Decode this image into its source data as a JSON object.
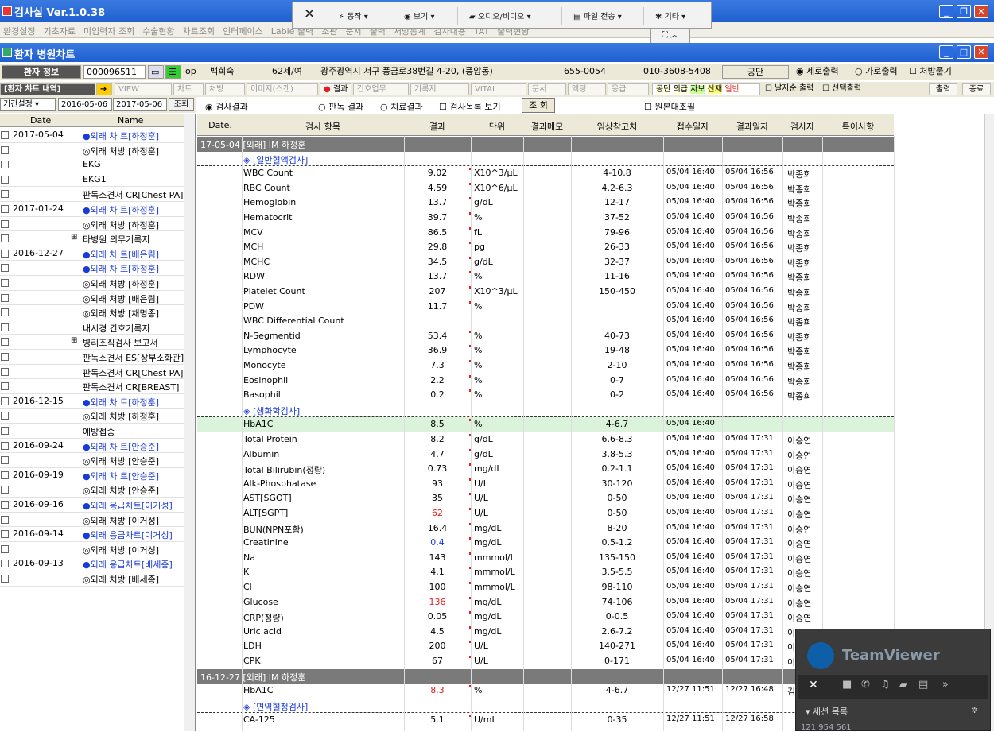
{
  "window": {
    "title": "검사실 Ver.1.0.38"
  },
  "menu": [
    "환경설정",
    "기초자료",
    "미입력자 조회",
    "수술현황",
    "차트조회",
    "인터페이스",
    "Lable 출력",
    "조판",
    "문서",
    "출력",
    "처방통계",
    "검사내용",
    "TAT",
    "출력현황"
  ],
  "teamviewer_toolbar": {
    "close": "✕",
    "actions": "동작",
    "view": "보기",
    "audio_video": "오디오/비디오",
    "file_transfer": "파일 전송",
    "extras": "기타"
  },
  "subwindow": {
    "title": "환자 병원차트"
  },
  "patient": {
    "label": "환자 정보",
    "id": "000096511",
    "op": "op",
    "name": "백희숙",
    "age_sex": "62세/여",
    "address": "광주광역시 서구 풍금로38번길 4-20, (풍암동)",
    "zip": "655-0054",
    "phone": "010-3608-5408",
    "insurance": "공단",
    "print_opts": [
      "세로출력",
      "가로출력",
      "처방풀기"
    ]
  },
  "chart_tabs": {
    "title": "[환자 챠트 내역]",
    "tabs": [
      "VIEW",
      "차트",
      "처방",
      "이미지(스캔)",
      "결과",
      "간호업무",
      "기록지",
      "VITAL",
      "문서",
      "액팅",
      "응급"
    ],
    "insurance_legend": [
      "공단",
      "의급",
      "자보",
      "산재",
      "일반"
    ],
    "checks": [
      "날자순 출력",
      "선택출력"
    ],
    "print": "출력",
    "exit": "종료"
  },
  "filter": {
    "label": "기간설정",
    "from": "2016-05-06",
    "to": "2017-05-06",
    "search": "조회"
  },
  "options": {
    "radio1": "검사결과",
    "radio2": "판독 결과",
    "radio3": "치료결과",
    "check1": "검사목록 보기",
    "search": "조 회",
    "check2": "원본대조필"
  },
  "left_list": {
    "headers": [
      "Date",
      "Name"
    ],
    "rows": [
      {
        "date": "2017-05-04",
        "name": "●외래 차  트[하정훈]",
        "blue": true
      },
      {
        "date": "",
        "name": "◎외래 처방 [하정훈]",
        "blue": false
      },
      {
        "date": "",
        "name": "EKG",
        "blue": false
      },
      {
        "date": "",
        "name": "EKG1",
        "blue": false
      },
      {
        "date": "",
        "name": "판독소견서 CR[Chest PA]",
        "blue": false
      },
      {
        "date": "2017-01-24",
        "name": "●외래 차  트[하정훈]",
        "blue": true
      },
      {
        "date": "",
        "name": "◎외래 처방 [하정훈]",
        "blue": false
      },
      {
        "date": "",
        "name": "타병원 의무기록지",
        "blue": false,
        "expand": "⊞"
      },
      {
        "date": "2016-12-27",
        "name": "●외래 차  트[배은림]",
        "blue": true
      },
      {
        "date": "",
        "name": "●외래 차  트[하정훈]",
        "blue": true
      },
      {
        "date": "",
        "name": "◎외래 처방 [하정훈]",
        "blue": false
      },
      {
        "date": "",
        "name": "◎외래 처방 [배은림]",
        "blue": false
      },
      {
        "date": "",
        "name": "◎외래 처방 [채명종]",
        "blue": false
      },
      {
        "date": "",
        "name": "내시경 간호기록지",
        "blue": false
      },
      {
        "date": "",
        "name": "병리조직검사 보고서",
        "blue": false,
        "expand": "⊞"
      },
      {
        "date": "",
        "name": "판독소견서 ES[상부소화관]",
        "blue": false
      },
      {
        "date": "",
        "name": "판독소견서 CR[Chest PA]",
        "blue": false
      },
      {
        "date": "",
        "name": "판독소견서 CR[BREAST]",
        "blue": false
      },
      {
        "date": "2016-12-15",
        "name": "●외래 차  트[하정훈]",
        "blue": true
      },
      {
        "date": "",
        "name": "◎외래 처방 [하정훈]",
        "blue": false
      },
      {
        "date": "",
        "name": "예방접종",
        "blue": false
      },
      {
        "date": "2016-09-24",
        "name": "●외래 차  트[안승준]",
        "blue": true
      },
      {
        "date": "",
        "name": "◎외래 처방 [안승준]",
        "blue": false
      },
      {
        "date": "2016-09-19",
        "name": "●외래 차  트[안승준]",
        "blue": true
      },
      {
        "date": "",
        "name": "◎외래 처방 [안승준]",
        "blue": false
      },
      {
        "date": "2016-09-16",
        "name": "●외래 응급차트[이거성]",
        "blue": true
      },
      {
        "date": "",
        "name": "◎외래 처방 [이거성]",
        "blue": false
      },
      {
        "date": "2016-09-14",
        "name": "●외래 응급차트[이거성]",
        "blue": true
      },
      {
        "date": "",
        "name": "◎외래 처방 [이거성]",
        "blue": false
      },
      {
        "date": "2016-09-13",
        "name": "●외래 응급차트[배세종]",
        "blue": true
      },
      {
        "date": "",
        "name": "◎외래 처방 [배세종]",
        "blue": false
      }
    ]
  },
  "results": {
    "headers": [
      "Date.",
      "검사 항목",
      "결과",
      "단위",
      "결과메모",
      "임상참고치",
      "접수일자",
      "결과일자",
      "검사자",
      "특이사항"
    ],
    "rows": [
      {
        "t": "grp",
        "text": "17-05-04  [외래]  IM 하정훈"
      },
      {
        "t": "cat",
        "text": "◈ [일반혈액검사]"
      },
      {
        "item": "WBC Count",
        "val": "9.02",
        "unit": "X10^3/μL",
        "ref": "4-10.8",
        "rcv": "05/04 16:40",
        "res": "05/04 16:56",
        "by": "박종희"
      },
      {
        "item": "RBC Count",
        "val": "4.59",
        "unit": "X10^6/μL",
        "ref": "4.2-6.3",
        "rcv": "05/04 16:40",
        "res": "05/04 16:56",
        "by": "박종희"
      },
      {
        "item": "Hemoglobin",
        "val": "13.7",
        "unit": "g/dL",
        "ref": "12-17",
        "rcv": "05/04 16:40",
        "res": "05/04 16:56",
        "by": "박종희"
      },
      {
        "item": "Hematocrit",
        "val": "39.7",
        "unit": "%",
        "ref": "37-52",
        "rcv": "05/04 16:40",
        "res": "05/04 16:56",
        "by": "박종희"
      },
      {
        "item": "MCV",
        "val": "86.5",
        "unit": "fL",
        "ref": "79-96",
        "rcv": "05/04 16:40",
        "res": "05/04 16:56",
        "by": "박종희"
      },
      {
        "item": "MCH",
        "val": "29.8",
        "unit": "pg",
        "ref": "26-33",
        "rcv": "05/04 16:40",
        "res": "05/04 16:56",
        "by": "박종희"
      },
      {
        "item": "MCHC",
        "val": "34.5",
        "unit": "g/dL",
        "ref": "32-37",
        "rcv": "05/04 16:40",
        "res": "05/04 16:56",
        "by": "박종희"
      },
      {
        "item": "RDW",
        "val": "13.7",
        "unit": "%",
        "ref": "11-16",
        "rcv": "05/04 16:40",
        "res": "05/04 16:56",
        "by": "박종희"
      },
      {
        "item": "Platelet Count",
        "val": "207",
        "unit": "X10^3/μL",
        "ref": "150-450",
        "rcv": "05/04 16:40",
        "res": "05/04 16:56",
        "by": "박종희"
      },
      {
        "item": "PDW",
        "val": "11.7",
        "unit": "%",
        "ref": "",
        "rcv": "05/04 16:40",
        "res": "05/04 16:56",
        "by": "박종희"
      },
      {
        "item": "WBC Differential Count",
        "val": "",
        "unit": "",
        "ref": "",
        "rcv": "05/04 16:40",
        "res": "05/04 16:56",
        "by": "박종희"
      },
      {
        "item": "N-Segmentid",
        "val": "53.4",
        "unit": "%",
        "ref": "40-73",
        "rcv": "05/04 16:40",
        "res": "05/04 16:56",
        "by": "박종희"
      },
      {
        "item": "Lymphocyte",
        "val": "36.9",
        "unit": "%",
        "ref": "19-48",
        "rcv": "05/04 16:40",
        "res": "05/04 16:56",
        "by": "박종희"
      },
      {
        "item": "Monocyte",
        "val": "7.3",
        "unit": "%",
        "ref": "2-10",
        "rcv": "05/04 16:40",
        "res": "05/04 16:56",
        "by": "박종희"
      },
      {
        "item": "Eosinophil",
        "val": "2.2",
        "unit": "%",
        "ref": "0-7",
        "rcv": "05/04 16:40",
        "res": "05/04 16:56",
        "by": "박종희"
      },
      {
        "item": "Basophil",
        "val": "0.2",
        "unit": "%",
        "ref": "0-2",
        "rcv": "05/04 16:40",
        "res": "05/04 16:56",
        "by": "박종희"
      },
      {
        "t": "cat",
        "text": "◈ [생화학검사]"
      },
      {
        "item": "HbA1C",
        "val": "8.5",
        "unit": "%",
        "ref": "4-6.7",
        "rcv": "05/04 16:40",
        "res": "",
        "by": "",
        "hl": true
      },
      {
        "item": "Total  Protein",
        "val": "8.2",
        "unit": "g/dL",
        "ref": "6.6-8.3",
        "rcv": "05/04 16:40",
        "res": "05/04 17:31",
        "by": "이승연"
      },
      {
        "item": "Albumin",
        "val": "4.7",
        "unit": "g/dL",
        "ref": "3.8-5.3",
        "rcv": "05/04 16:40",
        "res": "05/04 17:31",
        "by": "이승연"
      },
      {
        "item": "Total  Bilirubin(정량)",
        "val": "0.73",
        "unit": "mg/dL",
        "ref": "0.2-1.1",
        "rcv": "05/04 16:40",
        "res": "05/04 17:31",
        "by": "이승연"
      },
      {
        "item": "Alk-Phosphatase",
        "val": "93",
        "unit": "U/L",
        "ref": "30-120",
        "rcv": "05/04 16:40",
        "res": "05/04 17:31",
        "by": "이승연"
      },
      {
        "item": "AST[SGOT]",
        "val": "35",
        "unit": "U/L",
        "ref": "0-50",
        "rcv": "05/04 16:40",
        "res": "05/04 17:31",
        "by": "이승연"
      },
      {
        "item": "ALT[SGPT]",
        "val": "62",
        "unit": "U/L",
        "ref": "0-50",
        "rcv": "05/04 16:40",
        "res": "05/04 17:31",
        "by": "이승연",
        "flag": "red"
      },
      {
        "item": "BUN(NPN포함)",
        "val": "16.4",
        "unit": "mg/dL",
        "ref": "8-20",
        "rcv": "05/04 16:40",
        "res": "05/04 17:31",
        "by": "이승연"
      },
      {
        "item": "Creatinine",
        "val": "0.4",
        "unit": "mg/dL",
        "ref": "0.5-1.2",
        "rcv": "05/04 16:40",
        "res": "05/04 17:31",
        "by": "이승연",
        "flag": "blue"
      },
      {
        "item": "Na",
        "val": "143",
        "unit": "mmmol/L",
        "ref": "135-150",
        "rcv": "05/04 16:40",
        "res": "05/04 17:31",
        "by": "이승연"
      },
      {
        "item": "K",
        "val": "4.1",
        "unit": "mmmol/L",
        "ref": "3.5-5.5",
        "rcv": "05/04 16:40",
        "res": "05/04 17:31",
        "by": "이승연"
      },
      {
        "item": "Cl",
        "val": "100",
        "unit": "mmmol/L",
        "ref": "98-110",
        "rcv": "05/04 16:40",
        "res": "05/04 17:31",
        "by": "이승연"
      },
      {
        "item": "Glucose",
        "val": "136",
        "unit": "mg/dL",
        "ref": "74-106",
        "rcv": "05/04 16:40",
        "res": "05/04 17:31",
        "by": "이승연",
        "flag": "red"
      },
      {
        "item": "CRP(정량)",
        "val": "0.05",
        "unit": "mg/dL",
        "ref": "0-0.5",
        "rcv": "05/04 16:40",
        "res": "05/04 17:31",
        "by": "이승연"
      },
      {
        "item": "Uric acid",
        "val": "4.5",
        "unit": "mg/dL",
        "ref": "2.6-7.2",
        "rcv": "05/04 16:40",
        "res": "05/04 17:31",
        "by": "이"
      },
      {
        "item": "LDH",
        "val": "200",
        "unit": "U/L",
        "ref": "140-271",
        "rcv": "05/04 16:40",
        "res": "05/04 17:31",
        "by": "이"
      },
      {
        "item": "CPK",
        "val": "67",
        "unit": "U/L",
        "ref": "0-171",
        "rcv": "05/04 16:40",
        "res": "05/04 17:31",
        "by": "이"
      },
      {
        "t": "grp",
        "text": "16-12-27  [외래]  IM 하정훈"
      },
      {
        "item": "HbA1C",
        "val": "8.3",
        "unit": "%",
        "ref": "4-6.7",
        "rcv": "12/27 11:51",
        "res": "12/27 16:48",
        "by": "김",
        "flag": "red"
      },
      {
        "t": "cat",
        "text": "◈ [면역혈청검사]"
      },
      {
        "item": "CA-125",
        "val": "5.1",
        "unit": "U/mL",
        "ref": "0-35",
        "rcv": "12/27 11:51",
        "res": "12/27 16:58",
        "by": ""
      }
    ]
  },
  "teamviewer": {
    "logo": "TeamViewer",
    "session_list": "세션 목록",
    "id": "121 954 561"
  }
}
